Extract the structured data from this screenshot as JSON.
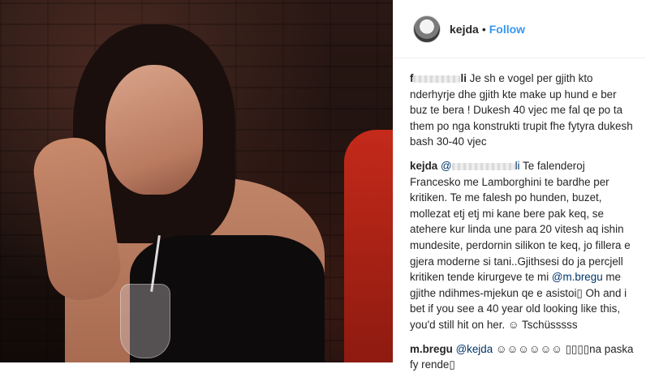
{
  "post": {
    "username": "kejda",
    "separator": "•",
    "follow_label": "Follow"
  },
  "comments": [
    {
      "author_visible": "f",
      "author_tail": "li",
      "text": "Je sh e vogel per gjith kto nderhyrje dhe gjith kte make up hund e ber buz te bera ! Dukesh 40 vjec me fal qe po ta them po nga konstrukti trupit fhe fytyra dukesh bash 30-40 vjec"
    },
    {
      "author": "kejda",
      "mention_prefix": "@",
      "mention_tail": "li",
      "text_part1": "Te falenderoj Francesko me Lamborghini te bardhe per kritiken. Te me falesh po hunden, buzet, mollezat etj etj mi kane bere pak keq, se atehere kur linda une para 20 vitesh aq ishin mundesite, perdornin silikon te keq, jo fillera e gjera moderne si tani..Gjithsesi do ja percjell kritiken tende kirurgeve te mi",
      "mention2": "@m.bregu",
      "text_part2": "me gjithe ndihmes-mjekun qe e asistoi▯ Oh and i bet if you see a 40 year old looking like this, you'd still hit on her. ☺ Tschüsssss"
    },
    {
      "author": "m.bregu",
      "mention": "@kejda",
      "text": "☺☺☺☺☺☺ ▯▯▯▯na paska fy rende▯"
    }
  ],
  "colors": {
    "link": "#3897f0",
    "mention": "#003569",
    "text": "#262626"
  }
}
